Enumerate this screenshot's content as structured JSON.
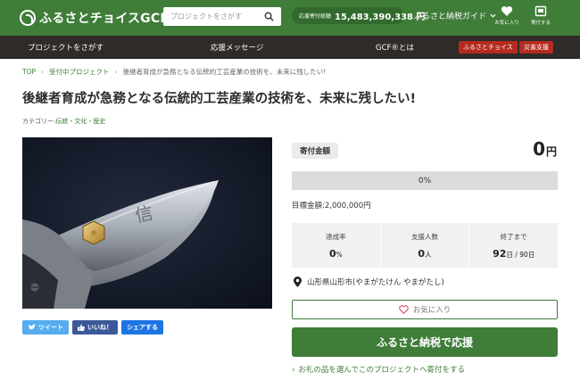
{
  "header": {
    "logo_text": "ふるさとチョイスGCF",
    "logo_sup": "®",
    "search_placeholder": "プロジェクトをさがす",
    "donation_label": "応援寄付総額",
    "donation_total": "15,483,390,338 円",
    "guide_label": "ふるさと納税ガイド",
    "favorites_label": "お気に入り",
    "donation_history_label": "寄付する",
    "colors": {
      "primary_green": "#3f7d39",
      "dark_nav": "#2e2b28",
      "badge_red": "#b52b1f"
    }
  },
  "nav": {
    "items": [
      "プロジェクトをさがす",
      "応援メッセージ",
      "GCF®とは"
    ],
    "badges": [
      "ふるさとチョイス",
      "災害支援"
    ]
  },
  "breadcrumb": [
    "TOP",
    "受付中プロジェクト",
    "後継者育成が急務となる伝統的工芸産業の技術を、未来に残したい!"
  ],
  "project": {
    "title": "後継者育成が急務となる伝統的工芸産業の技術を、未来に残したい!",
    "category_label": "カテゴリー:",
    "category_value": "伝統・文化・歴史",
    "amount_label": "寄付金額",
    "amount_value": "0",
    "amount_unit": "円",
    "progress_percent": 0,
    "progress_text": "0%",
    "target_text": "目標金額:2,000,000円",
    "stats": [
      {
        "label": "達成率",
        "value": "0",
        "unit": "%"
      },
      {
        "label": "支援人数",
        "value": "0",
        "unit": "人"
      },
      {
        "label": "終了まで",
        "value": "92",
        "unit": "日 / 90日"
      }
    ],
    "location": "山形県山形市(やまがたけん やまがたし)",
    "favorite_label": "お気に入り",
    "donate_label": "ふるさと納税で応援",
    "gift_link": "お礼の品を選んでこのプロジェクトへ寄付をする"
  },
  "share": {
    "tweet": "ツイート",
    "like": "いいね！",
    "share": "シェアする"
  }
}
